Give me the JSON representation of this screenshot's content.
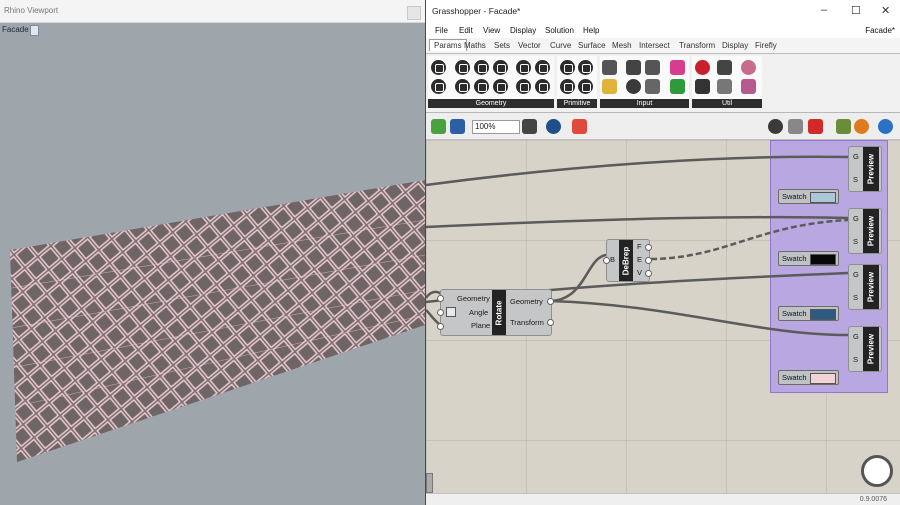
{
  "rhino": {
    "window_title": "Rhino Viewport",
    "viewport_label": "Facade"
  },
  "grasshopper": {
    "window_title": "Grasshopper - Facade*",
    "document_name": "Facade*",
    "window_controls": [
      "–",
      "☐",
      "✕"
    ],
    "menu": [
      "File",
      "Edit",
      "View",
      "Display",
      "Solution",
      "Help"
    ],
    "tabs": [
      "Params",
      "Maths",
      "Sets",
      "Vector",
      "Curve",
      "Surface",
      "Mesh",
      "Intersect",
      "Transform",
      "Display",
      "Firefly"
    ],
    "active_tab": "Params",
    "ribbon_panels": [
      "Geometry",
      "Primitive",
      "Input",
      "Util"
    ],
    "zoom": "100%",
    "status_text": "0.9.0076"
  },
  "canvas": {
    "rotate": {
      "name": "Rotate",
      "inputs": [
        "Geometry",
        "Angle",
        "Plane"
      ],
      "outputs": [
        "Geometry",
        "Transform"
      ]
    },
    "debrep": {
      "name": "DeBrep",
      "input": "B",
      "outputs": [
        "F",
        "E",
        "V"
      ]
    },
    "previews": [
      {
        "name": "Preview",
        "inputs": [
          "G",
          "S"
        ],
        "swatch_label": "Swatch",
        "color": "#a9c7d6"
      },
      {
        "name": "Preview",
        "inputs": [
          "G",
          "S"
        ],
        "swatch_label": "Swatch",
        "color": "#080808"
      },
      {
        "name": "Preview",
        "inputs": [
          "G",
          "S"
        ],
        "swatch_label": "Swatch",
        "color": "#2b5a82"
      },
      {
        "name": "Preview",
        "inputs": [
          "G",
          "S"
        ],
        "swatch_label": "Swatch",
        "color": "#f1d3d5"
      }
    ]
  },
  "colors": {
    "group_fill": "#b9a7e2",
    "canvas_bg": "#d7d3c8",
    "facade_panel": "#7a6e70",
    "facade_edge": "#f0cfd4"
  }
}
